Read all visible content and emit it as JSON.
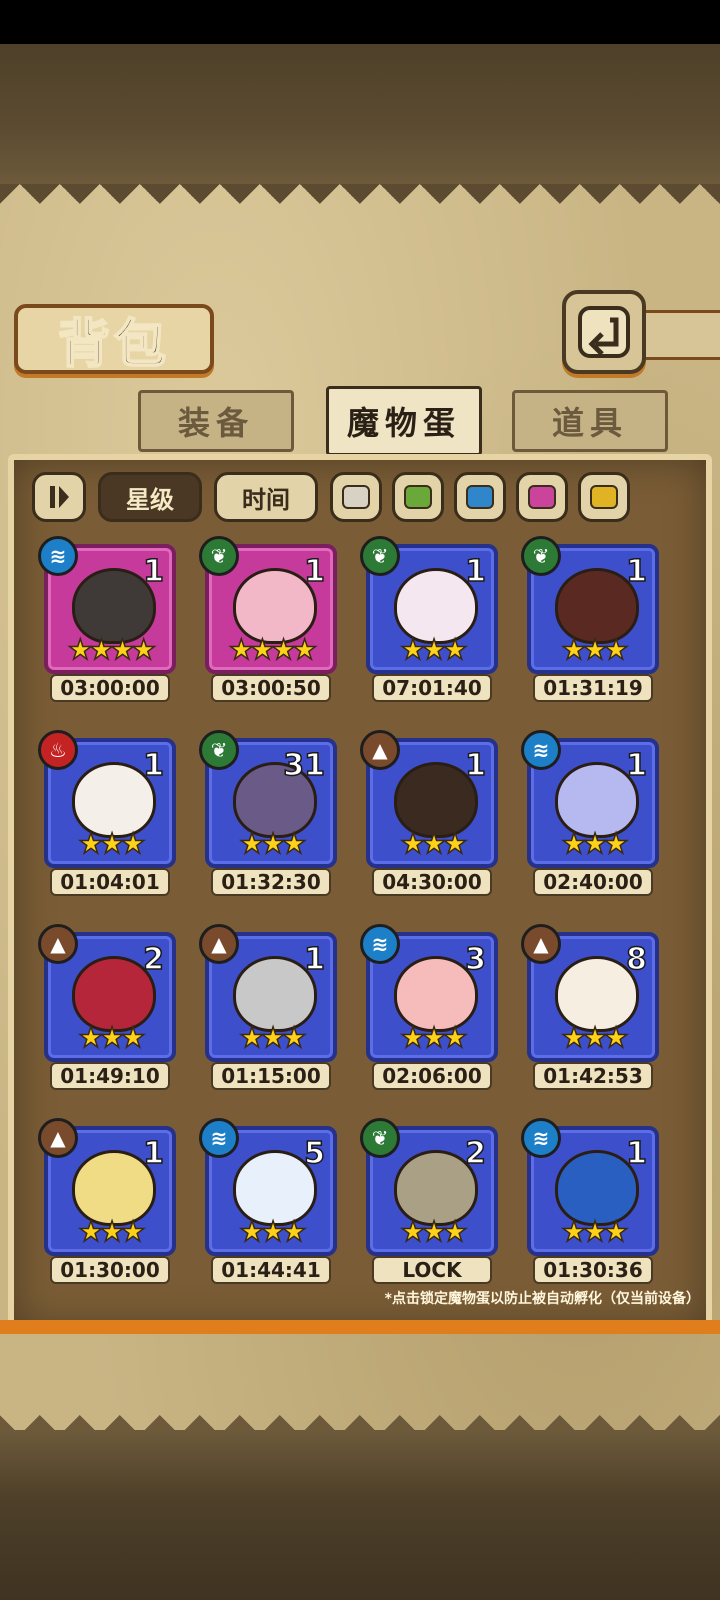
{
  "title": "背包",
  "tabs": [
    {
      "label": "装备",
      "active": false
    },
    {
      "label": "魔物蛋",
      "active": true
    },
    {
      "label": "道具",
      "active": false
    }
  ],
  "filters": {
    "sort_icon": "sort-toggle-icon",
    "star_label": "星级",
    "time_label": "时间",
    "colors": [
      "#d8d2c4",
      "#6aa83a",
      "#2f86c8",
      "#c9449a",
      "#e0b324"
    ]
  },
  "eggs": [
    {
      "element": "water",
      "count": "1",
      "stars": 4,
      "timer": "03:00:00",
      "frame": "pink",
      "art_color": "#3f3a38"
    },
    {
      "element": "leaf",
      "count": "1",
      "stars": 4,
      "timer": "03:00:50",
      "frame": "pink",
      "art_color": "#f2b8c8"
    },
    {
      "element": "leaf",
      "count": "1",
      "stars": 3,
      "timer": "07:01:40",
      "frame": "blue",
      "art_color": "#f4e7ef"
    },
    {
      "element": "leaf",
      "count": "1",
      "stars": 3,
      "timer": "01:31:19",
      "frame": "blue",
      "art_color": "#5a2a22"
    },
    {
      "element": "fire",
      "count": "1",
      "stars": 3,
      "timer": "01:04:01",
      "frame": "blue",
      "art_color": "#f4efe8"
    },
    {
      "element": "leaf",
      "count": "31",
      "stars": 3,
      "timer": "01:32:30",
      "frame": "blue",
      "art_color": "#6a5a88"
    },
    {
      "element": "earth",
      "count": "1",
      "stars": 3,
      "timer": "04:30:00",
      "frame": "blue",
      "art_color": "#3a2a20"
    },
    {
      "element": "water",
      "count": "1",
      "stars": 3,
      "timer": "02:40:00",
      "frame": "blue",
      "art_color": "#b6b8f0"
    },
    {
      "element": "earth",
      "count": "2",
      "stars": 3,
      "timer": "01:49:10",
      "frame": "blue",
      "art_color": "#b5263a"
    },
    {
      "element": "earth",
      "count": "1",
      "stars": 3,
      "timer": "01:15:00",
      "frame": "blue",
      "art_color": "#c8c8c8"
    },
    {
      "element": "water",
      "count": "3",
      "stars": 3,
      "timer": "02:06:00",
      "frame": "blue",
      "art_color": "#f6bcbc"
    },
    {
      "element": "earth",
      "count": "8",
      "stars": 3,
      "timer": "01:42:53",
      "frame": "blue",
      "art_color": "#f7eee2"
    },
    {
      "element": "earth",
      "count": "1",
      "stars": 3,
      "timer": "01:30:00",
      "frame": "blue",
      "art_color": "#f1dc86"
    },
    {
      "element": "water",
      "count": "5",
      "stars": 3,
      "timer": "01:44:41",
      "frame": "blue",
      "art_color": "#e7f0fb"
    },
    {
      "element": "leaf",
      "count": "2",
      "stars": 3,
      "timer": "LOCK",
      "frame": "blue",
      "art_color": "#a9a086"
    },
    {
      "element": "water",
      "count": "1",
      "stars": 3,
      "timer": "01:30:36",
      "frame": "blue",
      "art_color": "#2a5fc2"
    }
  ],
  "note": "*点击锁定魔物蛋以防止被自动孵化（仅当前设备）"
}
